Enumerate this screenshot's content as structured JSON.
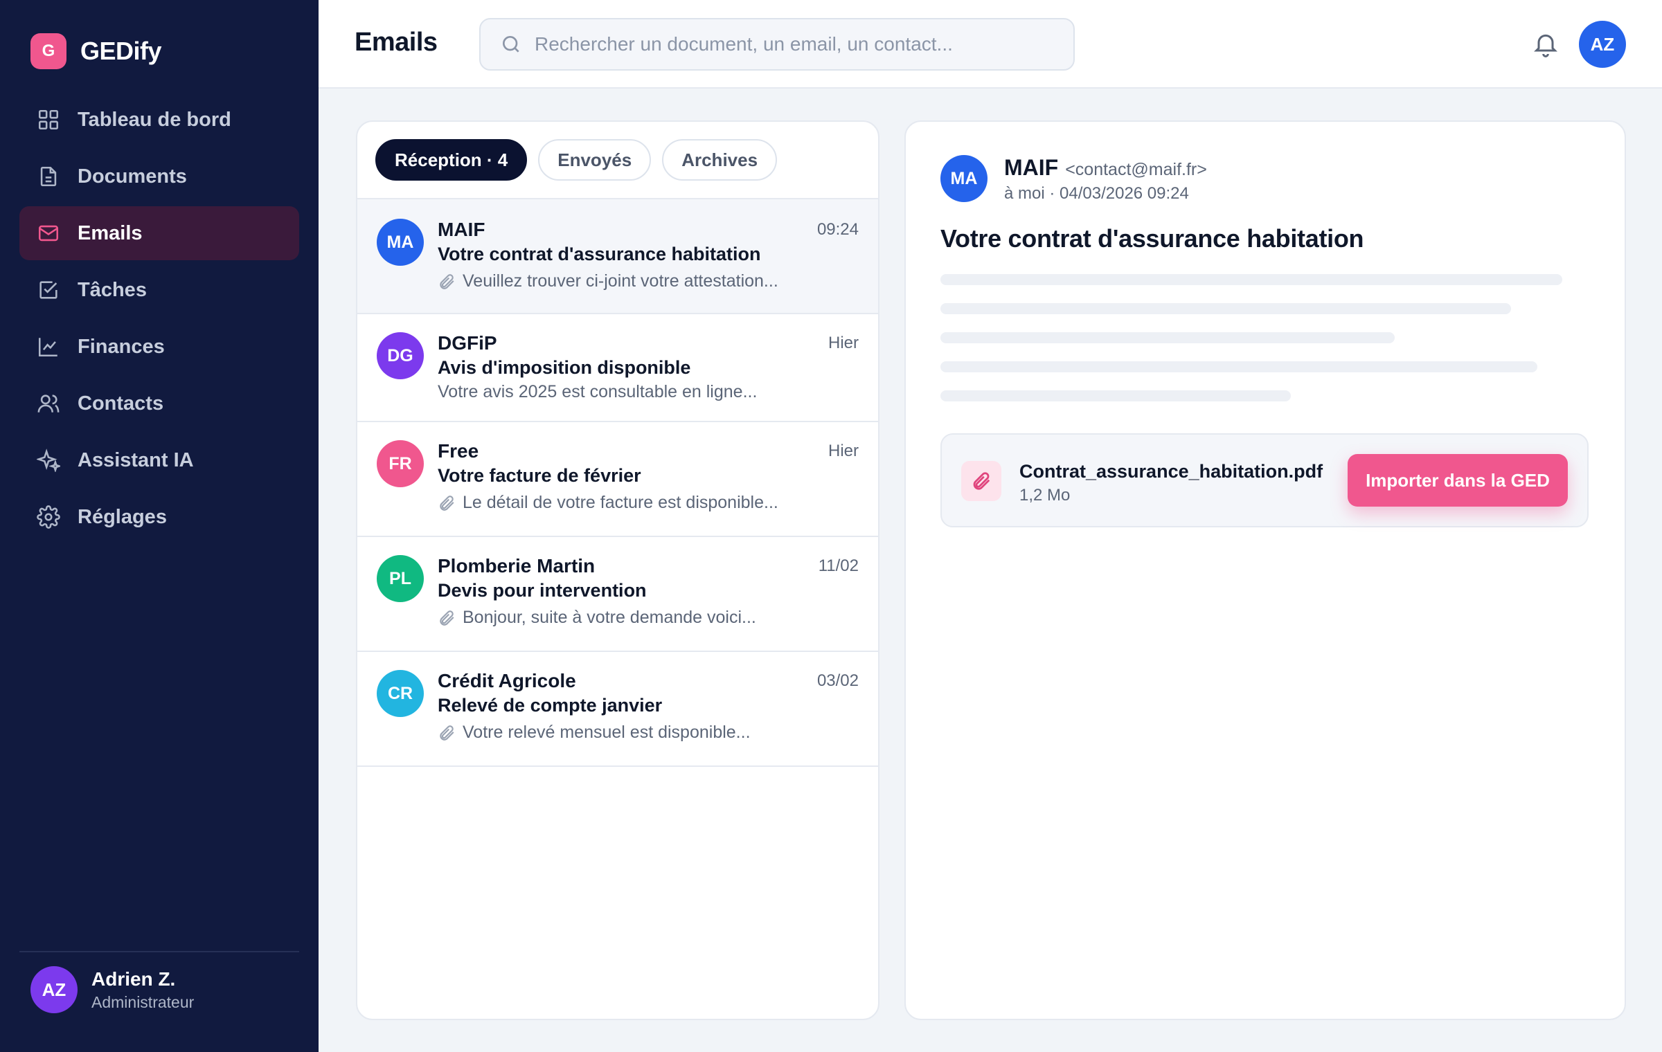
{
  "brand": {
    "logo_letter": "G",
    "name": "GEDify",
    "accent": "#f0578e"
  },
  "sidebar": {
    "items": [
      {
        "label": "Tableau de bord",
        "icon": "dashboard-icon"
      },
      {
        "label": "Documents",
        "icon": "document-icon"
      },
      {
        "label": "Emails",
        "icon": "mail-icon",
        "active": true
      },
      {
        "label": "Tâches",
        "icon": "task-check-icon"
      },
      {
        "label": "Finances",
        "icon": "chart-line-icon"
      },
      {
        "label": "Contacts",
        "icon": "contacts-icon"
      },
      {
        "label": "Assistant IA",
        "icon": "sparkle-icon"
      },
      {
        "label": "Réglages",
        "icon": "gear-icon"
      }
    ],
    "user": {
      "initials": "AZ",
      "name": "Adrien Z.",
      "role": "Administrateur"
    }
  },
  "header": {
    "title": "Emails",
    "search_placeholder": "Rechercher un document, un email, un contact...",
    "avatar_initials": "AZ"
  },
  "tabs": [
    {
      "label": "Réception · 4",
      "active": true
    },
    {
      "label": "Envoyés"
    },
    {
      "label": "Archives"
    }
  ],
  "emails": [
    {
      "initials": "MA",
      "color": "#2563eb",
      "sender": "MAIF",
      "time": "09:24",
      "subject": "Votre contrat d'assurance habitation",
      "preview": "Veuillez trouver ci-joint votre attestation...",
      "attachment": true,
      "selected": true
    },
    {
      "initials": "DG",
      "color": "#7c3aed",
      "sender": "DGFiP",
      "time": "Hier",
      "subject": "Avis d'imposition disponible",
      "preview": "Votre avis 2025 est consultable en ligne...",
      "attachment": false
    },
    {
      "initials": "FR",
      "color": "#f0578e",
      "sender": "Free",
      "time": "Hier",
      "subject": "Votre facture de février",
      "preview": "Le détail de votre facture est disponible...",
      "attachment": true
    },
    {
      "initials": "PL",
      "color": "#10b981",
      "sender": "Plomberie Martin",
      "time": "11/02",
      "subject": "Devis pour intervention",
      "preview": "Bonjour, suite à votre demande voici...",
      "attachment": true
    },
    {
      "initials": "CR",
      "color": "#22b5e0",
      "sender": "Crédit Agricole",
      "time": "03/02",
      "subject": "Relevé de compte janvier",
      "preview": "Votre relevé mensuel est disponible...",
      "attachment": true
    }
  ],
  "detail": {
    "initials": "MA",
    "sender": "MAIF",
    "email": "<contact@maif.fr>",
    "meta": "à moi · 04/03/2026 09:24",
    "subject": "Votre contrat d'assurance habitation",
    "attachment": {
      "name": "Contrat_assurance_habitation.pdf",
      "size": "1,2 Mo",
      "import_label": "Importer dans la GED"
    }
  }
}
